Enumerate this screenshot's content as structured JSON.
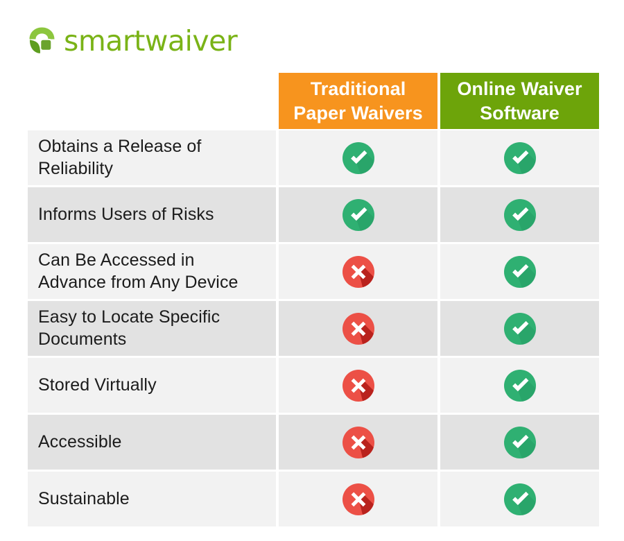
{
  "brand": {
    "name": "smartwaiver",
    "logo_icon": "smartwaiver-leaf-logo-icon",
    "wordmark_color": "#7ab317",
    "mark_light_green": "#8cc63e",
    "mark_dark_green": "#6ba32e"
  },
  "table": {
    "columns": [
      {
        "key": "feature",
        "label": "",
        "accent": ""
      },
      {
        "key": "paper",
        "label": "Traditional\nPaper Waivers",
        "line1": "Traditional",
        "line2": "Paper Waivers",
        "accent": "#f7941e"
      },
      {
        "key": "online",
        "label": "Online Waiver\nSoftware",
        "line1": "Online Waiver",
        "line2": "Software",
        "accent": "#6da40a"
      }
    ],
    "row_colors": {
      "odd": "#f2f2f2",
      "even": "#e2e2e2"
    },
    "icons": {
      "yes": {
        "name": "check-circle-icon",
        "circle": "#2fb072",
        "shadow": "#1d8a56",
        "glyph": "#ffffff"
      },
      "no": {
        "name": "x-circle-icon",
        "circle": "#ec5046",
        "shadow": "#b01a16",
        "glyph": "#ffffff"
      }
    },
    "rows": [
      {
        "label": "Obtains a Release of Reliability",
        "paper": "yes",
        "online": "yes"
      },
      {
        "label": "Informs Users of Risks",
        "paper": "yes",
        "online": "yes"
      },
      {
        "label": "Can Be Accessed in Advance from Any Device",
        "paper": "no",
        "online": "yes"
      },
      {
        "label": "Easy to Locate Specific Documents",
        "paper": "no",
        "online": "yes"
      },
      {
        "label": "Stored Virtually",
        "paper": "no",
        "online": "yes"
      },
      {
        "label": "Accessible",
        "paper": "no",
        "online": "yes"
      },
      {
        "label": "Sustainable",
        "paper": "no",
        "online": "yes"
      }
    ]
  }
}
